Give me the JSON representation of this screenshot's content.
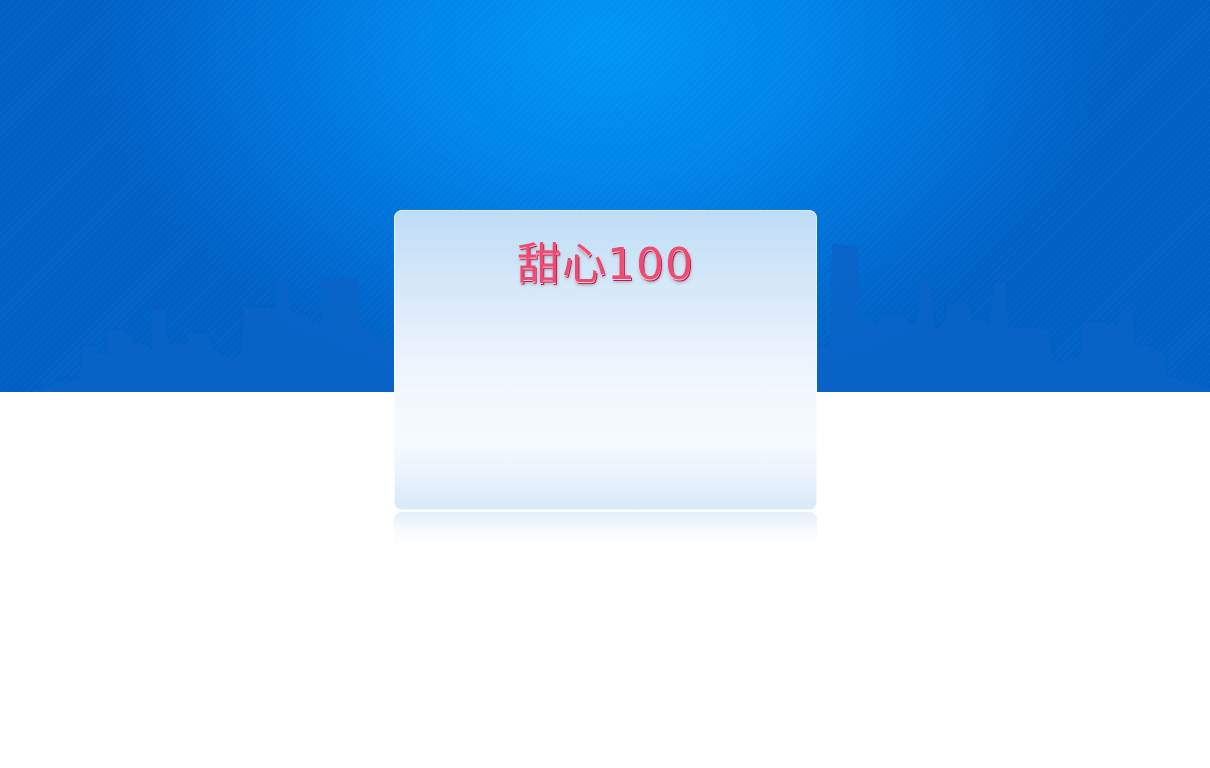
{
  "header": {
    "brand_title": "甜心100"
  },
  "colors": {
    "sky_center": "#0096f4",
    "sky_edge": "#0060c4",
    "skyline": "#0b64c8",
    "card_top": "#bedcf6",
    "card_bottom": "#d7e9f8",
    "title": "#ee4b72",
    "page_background": "#ffffff"
  }
}
